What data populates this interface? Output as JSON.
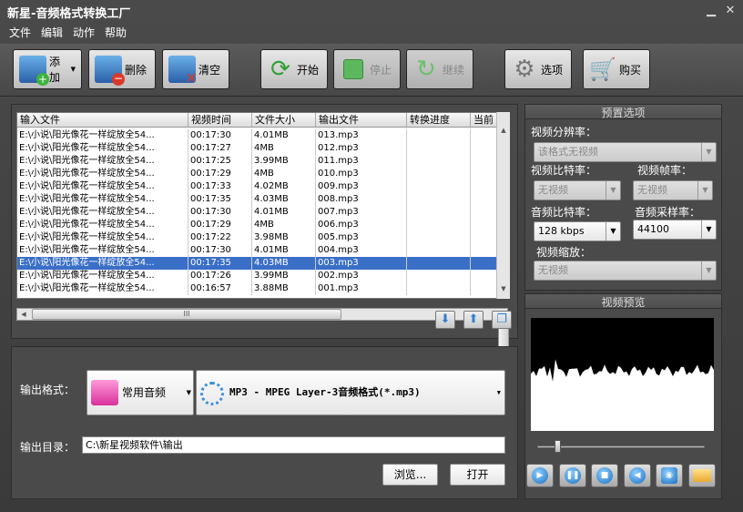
{
  "title": "新星-音频格式转换工厂",
  "window_controls": {
    "min": "▁",
    "close": "✕"
  },
  "menu": [
    "文件",
    "编辑",
    "动作",
    "帮助"
  ],
  "toolbar": {
    "add": "添加",
    "add_arrow": "▼",
    "delete": "删除",
    "clear": "清空",
    "start": "开始",
    "stop": "停止",
    "continue": "继续",
    "options": "选项",
    "buy": "购买"
  },
  "columns": [
    "输入文件",
    "视频时间",
    "文件大小",
    "输出文件",
    "转换进度",
    "当前"
  ],
  "rows": [
    {
      "input": "E:\\小说\\阳光像花一样绽放全54...",
      "time": "00:17:30",
      "size": "4.01MB",
      "output": "013.mp3"
    },
    {
      "input": "E:\\小说\\阳光像花一样绽放全54...",
      "time": "00:17:27",
      "size": "4MB",
      "output": "012.mp3"
    },
    {
      "input": "E:\\小说\\阳光像花一样绽放全54...",
      "time": "00:17:25",
      "size": "3.99MB",
      "output": "011.mp3"
    },
    {
      "input": "E:\\小说\\阳光像花一样绽放全54...",
      "time": "00:17:29",
      "size": "4MB",
      "output": "010.mp3"
    },
    {
      "input": "E:\\小说\\阳光像花一样绽放全54...",
      "time": "00:17:33",
      "size": "4.02MB",
      "output": "009.mp3"
    },
    {
      "input": "E:\\小说\\阳光像花一样绽放全54...",
      "time": "00:17:35",
      "size": "4.03MB",
      "output": "008.mp3"
    },
    {
      "input": "E:\\小说\\阳光像花一样绽放全54...",
      "time": "00:17:30",
      "size": "4.01MB",
      "output": "007.mp3"
    },
    {
      "input": "E:\\小说\\阳光像花一样绽放全54...",
      "time": "00:17:29",
      "size": "4MB",
      "output": "006.mp3"
    },
    {
      "input": "E:\\小说\\阳光像花一样绽放全54...",
      "time": "00:17:22",
      "size": "3.98MB",
      "output": "005.mp3"
    },
    {
      "input": "E:\\小说\\阳光像花一样绽放全54...",
      "time": "00:17:30",
      "size": "4.01MB",
      "output": "004.mp3"
    },
    {
      "input": "E:\\小说\\阳光像花一样绽放全54...",
      "time": "00:17:35",
      "size": "4.03MB",
      "output": "003.mp3",
      "selected": true
    },
    {
      "input": "E:\\小说\\阳光像花一样绽放全54...",
      "time": "00:17:26",
      "size": "3.99MB",
      "output": "002.mp3"
    },
    {
      "input": "E:\\小说\\阳光像花一样绽放全54...",
      "time": "00:16:57",
      "size": "3.88MB",
      "output": "001.mp3"
    }
  ],
  "preset": {
    "title": "预置选项",
    "video_res_label": "视频分辨率：",
    "video_res_value": "该格式无视频",
    "video_bitrate_label": "视频比特率：",
    "video_bitrate_value": "无视频",
    "video_fps_label": "视频帧率：",
    "video_fps_value": "无视频",
    "audio_bitrate_label": "音频比特率：",
    "audio_bitrate_value": "128 kbps",
    "audio_rate_label": "音频采样率：",
    "audio_rate_value": "44100",
    "video_scale_label": "视频缩放：",
    "video_scale_value": "无视频"
  },
  "preview": {
    "title": "视频预览"
  },
  "output": {
    "format_label": "输出格式：",
    "category": "常用音频",
    "format": "MP3 - MPEG Layer-3音频格式(*.mp3)",
    "dir_label": "输出目录：",
    "dir_value": "C:\\新星视频软件\\输出",
    "browse": "浏览...",
    "open": "打开"
  },
  "scroll_marker": "III",
  "colors": {
    "accent": "#3a6fc7",
    "background": "#3c3c3c"
  }
}
